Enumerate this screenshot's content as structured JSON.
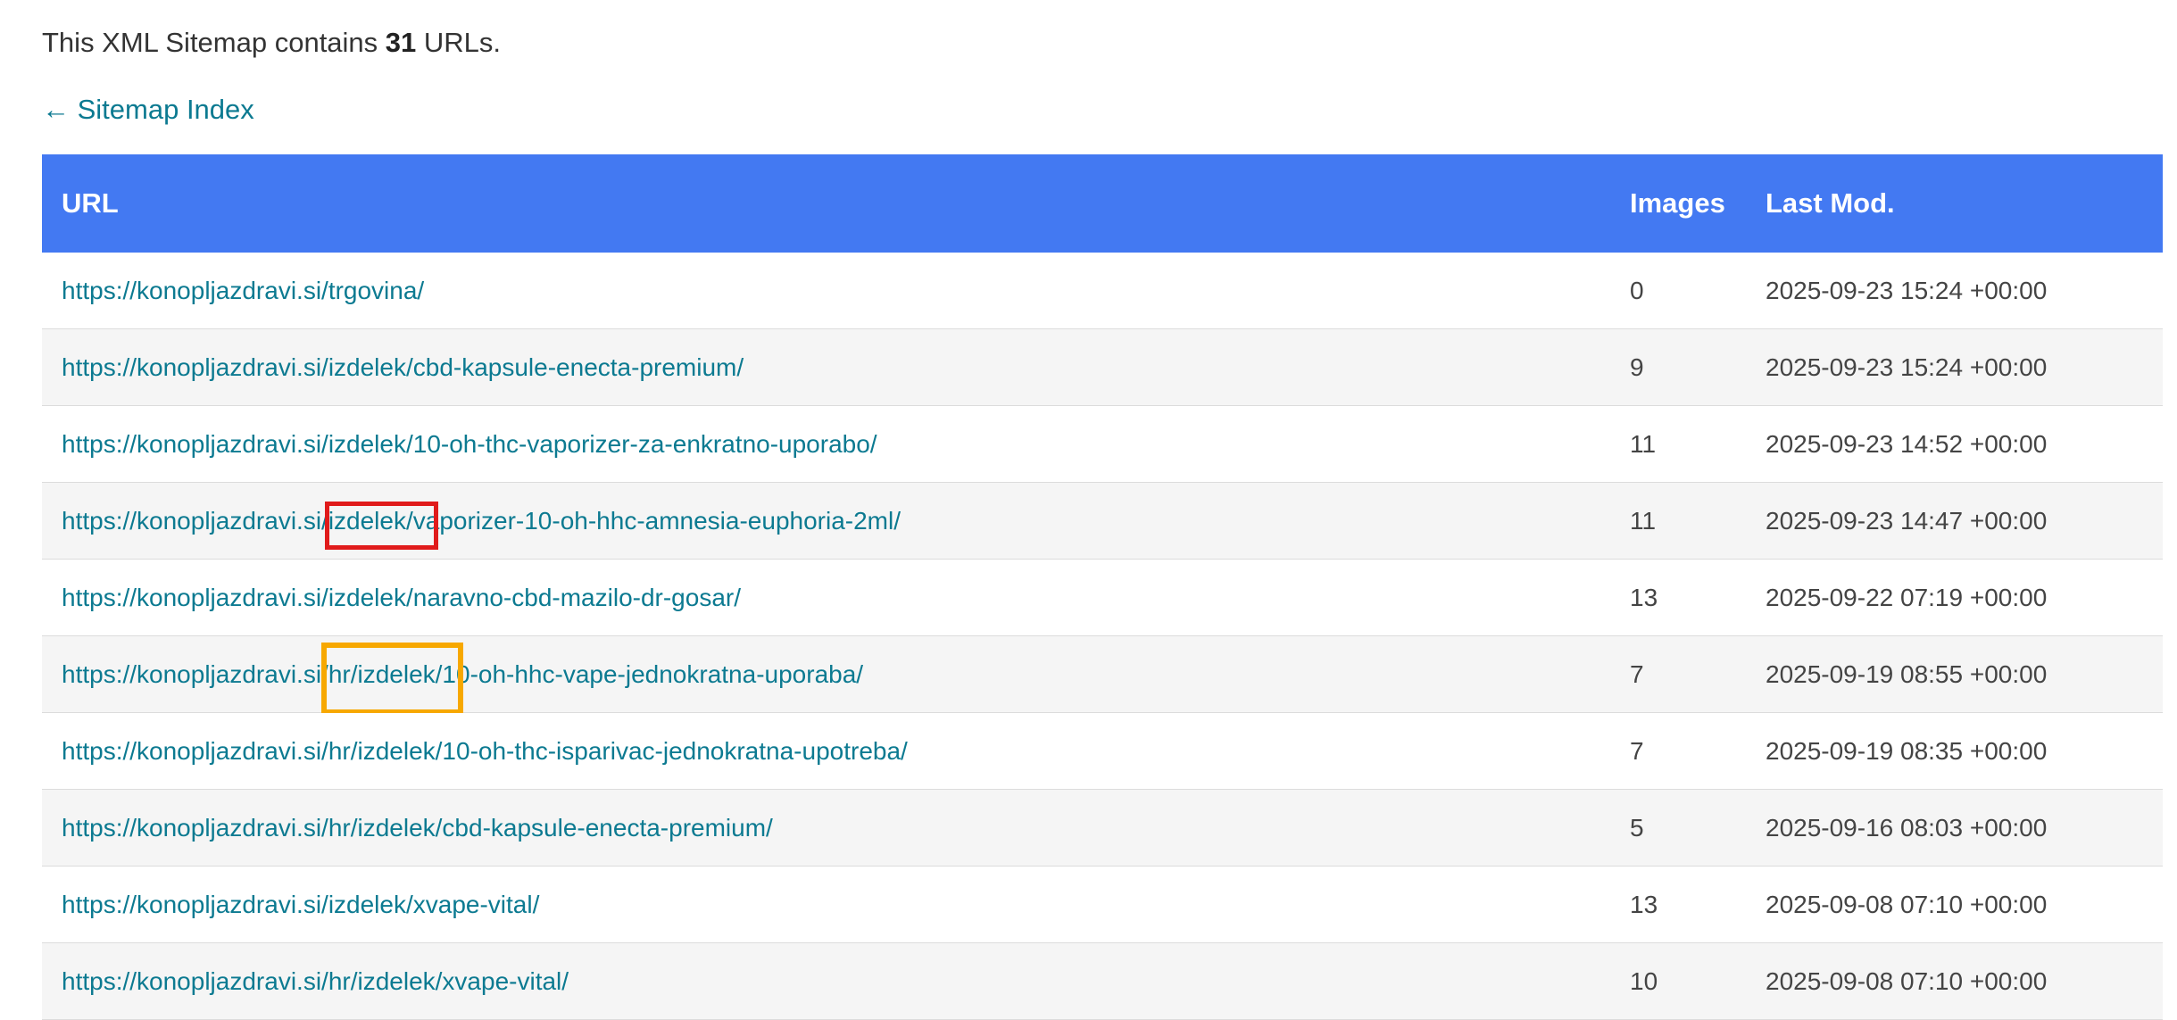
{
  "intro": {
    "prefix": "This XML Sitemap contains ",
    "count": "31",
    "suffix": " URLs."
  },
  "back_link": {
    "label": "← Sitemap Index"
  },
  "table": {
    "headers": {
      "url": "URL",
      "images": "Images",
      "last_mod": "Last Mod."
    },
    "rows": [
      {
        "url": "https://konopljazdravi.si/trgovina/",
        "images": "0",
        "last_mod": "2025-09-23 15:24 +00:00"
      },
      {
        "url": "https://konopljazdravi.si/izdelek/cbd-kapsule-enecta-premium/",
        "images": "9",
        "last_mod": "2025-09-23 15:24 +00:00"
      },
      {
        "url": "https://konopljazdravi.si/izdelek/10-oh-thc-vaporizer-za-enkratno-uporabo/",
        "images": "11",
        "last_mod": "2025-09-23 14:52 +00:00"
      },
      {
        "url": "https://konopljazdravi.si/izdelek/vaporizer-10-oh-hhc-amnesia-euphoria-2ml/",
        "images": "11",
        "last_mod": "2025-09-23 14:47 +00:00"
      },
      {
        "url": "https://konopljazdravi.si/izdelek/naravno-cbd-mazilo-dr-gosar/",
        "images": "13",
        "last_mod": "2025-09-22 07:19 +00:00"
      },
      {
        "url": "https://konopljazdravi.si/hr/izdelek/10-oh-hhc-vape-jednokratna-uporaba/",
        "images": "7",
        "last_mod": "2025-09-19 08:55 +00:00"
      },
      {
        "url": "https://konopljazdravi.si/hr/izdelek/10-oh-thc-isparivac-jednokratna-upotreba/",
        "images": "7",
        "last_mod": "2025-09-19 08:35 +00:00"
      },
      {
        "url": "https://konopljazdravi.si/hr/izdelek/cbd-kapsule-enecta-premium/",
        "images": "5",
        "last_mod": "2025-09-16 08:03 +00:00"
      },
      {
        "url": "https://konopljazdravi.si/izdelek/xvape-vital/",
        "images": "13",
        "last_mod": "2025-09-08 07:10 +00:00"
      },
      {
        "url": "https://konopljazdravi.si/hr/izdelek/xvape-vital/",
        "images": "10",
        "last_mod": "2025-09-08 07:10 +00:00"
      }
    ]
  },
  "annotations": {
    "red_highlight_color": "#e01b1b",
    "orange_highlight_color": "#f7a800",
    "header_color": "#4379f2",
    "link_color": "#0c7a91"
  }
}
